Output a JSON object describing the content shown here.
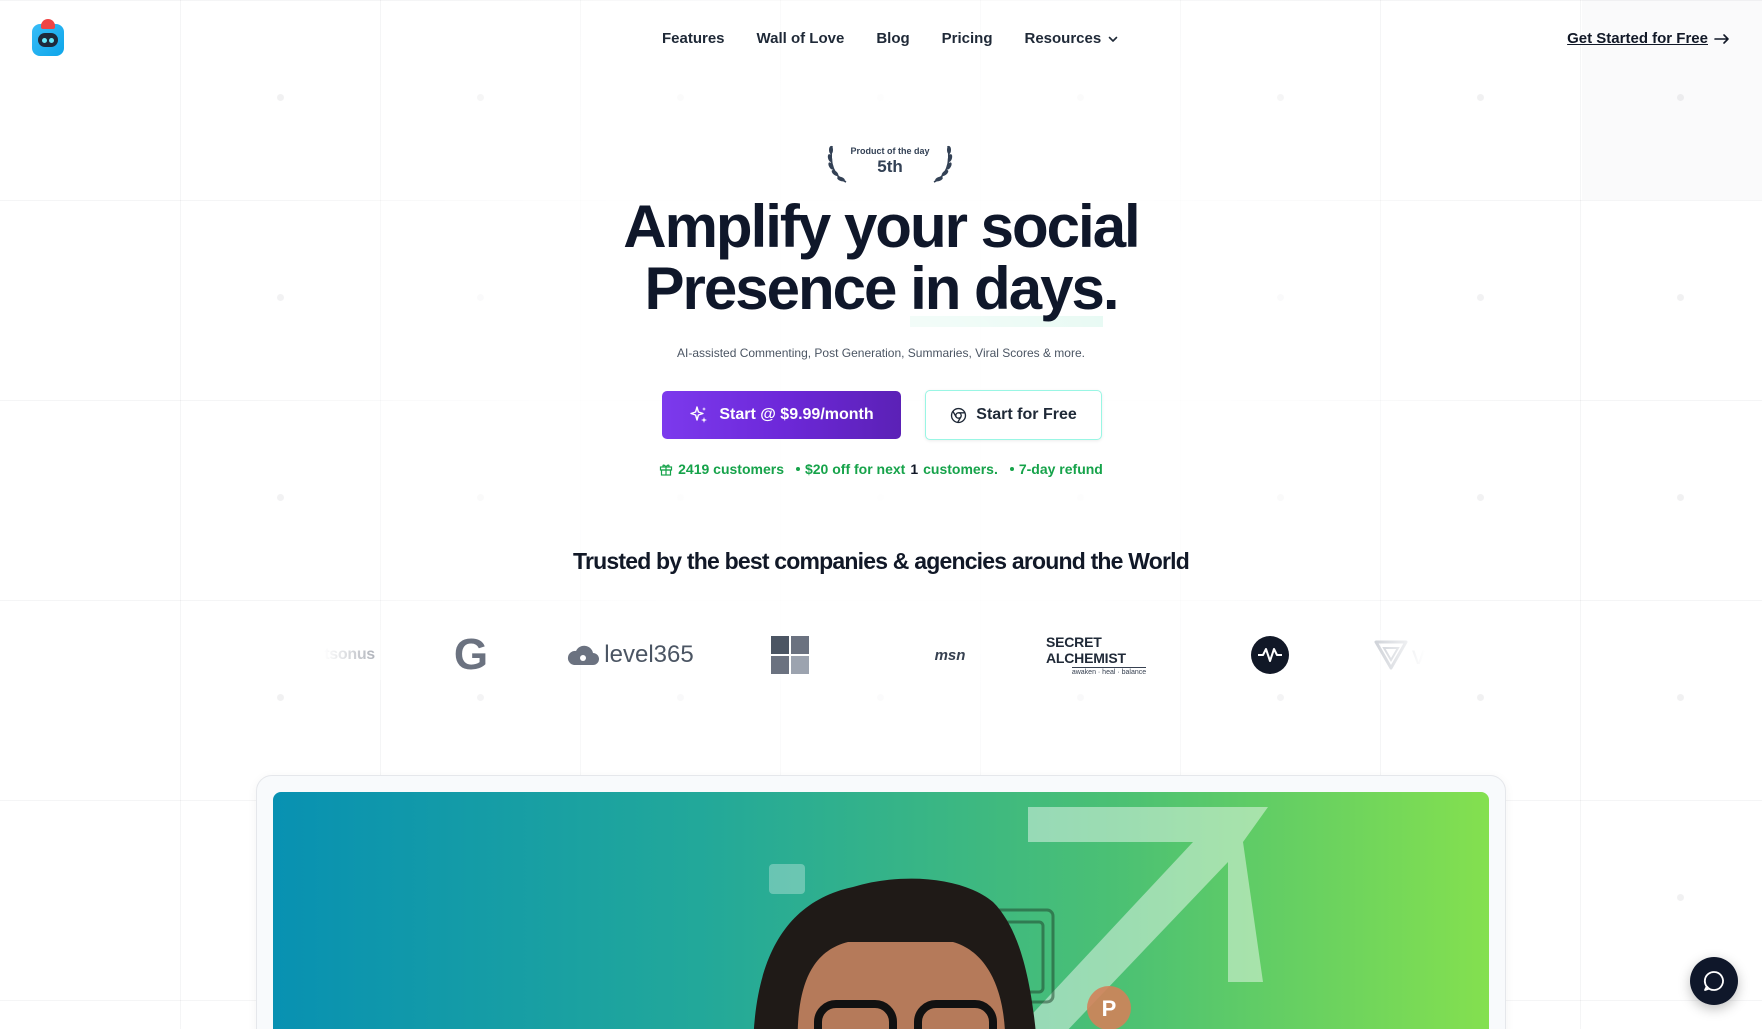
{
  "nav": {
    "logo_alt": "app logo",
    "links": [
      {
        "label": "Features"
      },
      {
        "label": "Wall of Love"
      },
      {
        "label": "Blog"
      },
      {
        "label": "Pricing"
      },
      {
        "label": "Resources"
      }
    ],
    "cta": "Get Started for Free"
  },
  "hero": {
    "award": {
      "label": "Product of the day",
      "value": "5th"
    },
    "title_line1": "Amplify your social",
    "title_line2_prefix": "Presence ",
    "title_highlight": "in days",
    "title_suffix": ".",
    "subtitle": "AI-assisted Commenting, Post Generation, Summaries, Viral Scores & more.",
    "primary_button": "Start @ $9.99/month",
    "secondary_button": "Start for Free",
    "stats": {
      "customers": "2419 customers",
      "offer_prefix": "$20 off for next ",
      "offer_count": "1",
      "offer_suffix": " customers.",
      "refund": "7-day refund"
    }
  },
  "trusted": {
    "heading": "Trusted by the best companies & agencies around the World",
    "logos": [
      {
        "name": "fitsonus",
        "text": "fitsonus"
      },
      {
        "name": "google",
        "text": "G"
      },
      {
        "name": "level365",
        "text": "level365"
      },
      {
        "name": "windows",
        "text": ""
      },
      {
        "name": "msn",
        "text": "msn"
      },
      {
        "name": "secret-alchemist",
        "text": "SECRET ALCHEMIST",
        "tagline": "awaken · heal · balance"
      },
      {
        "name": "wave",
        "text": ""
      },
      {
        "name": "vipr",
        "text": "vipr"
      }
    ]
  },
  "colors": {
    "primary": "#6d28d9",
    "accent_green": "#34d399",
    "stat_green": "#16a34a",
    "dark": "#0f172a"
  }
}
